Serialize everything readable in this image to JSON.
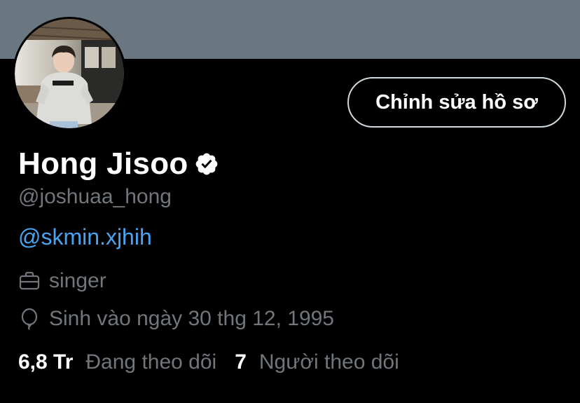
{
  "profile": {
    "banner_color": "#6a7781",
    "edit_button_label": "Chỉnh sửa hồ sơ",
    "display_name": "Hong Jisoo",
    "verified_icon": "verified-badge-icon",
    "handle": "@joshuaa_hong",
    "bio_link": "@skmin.xjhih",
    "profession_icon": "briefcase-icon",
    "profession": "singer",
    "birthday_icon": "balloon-icon",
    "birthday": "Sinh vào ngày 30 thg 12, 1995",
    "following_count": "6,8 Tr",
    "following_label": "Đang theo dõi",
    "followers_count": "7",
    "followers_label": "Người theo dõi"
  },
  "colors": {
    "background": "#000000",
    "primary_text": "#ffffff",
    "secondary_text": "#71767b",
    "link": "#4aa3f0",
    "button_border": "#cfd9de"
  }
}
